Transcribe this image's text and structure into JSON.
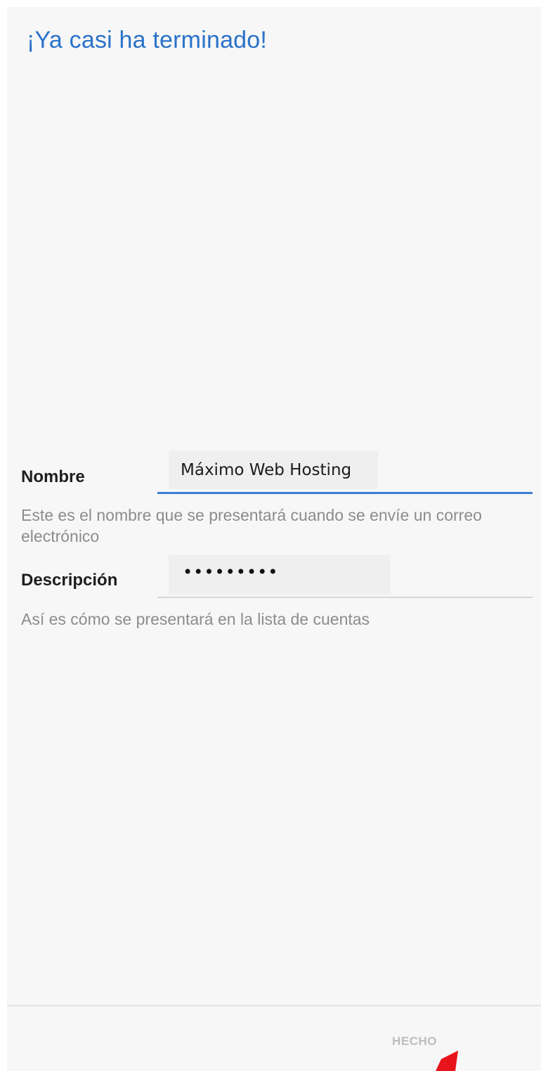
{
  "header": {
    "title": "¡Ya casi ha terminado!"
  },
  "form": {
    "name_field": {
      "label": "Nombre",
      "value": "Máximo Web Hosting",
      "help": "Este es el nombre que se presentará cuando se envíe un correo electrónico"
    },
    "description_field": {
      "label": "Descripción",
      "value_masked": "•••••••••",
      "help": "Así es cómo se presentará en la lista de cuentas"
    }
  },
  "footer": {
    "done_label": "HECHO"
  },
  "colors": {
    "title": "#2a72c9",
    "active_underline": "#3b7fd4",
    "help_text": "#8c8c8c",
    "disabled_button": "#bdbdbd",
    "annotation_arrow": "#e8141b"
  }
}
